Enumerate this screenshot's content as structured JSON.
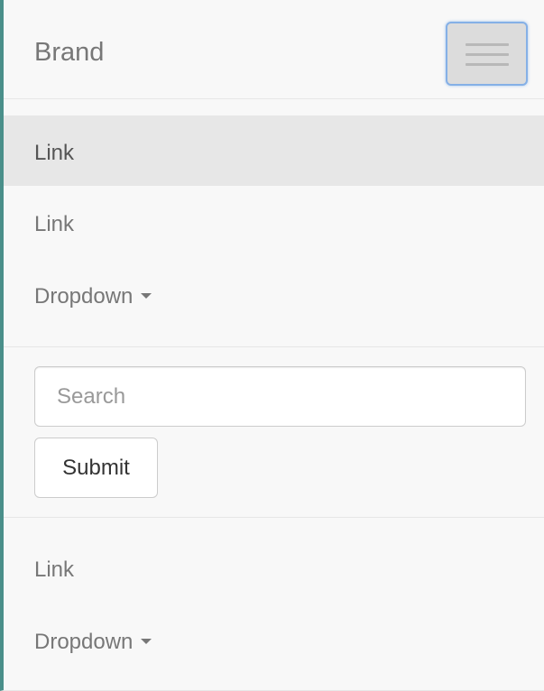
{
  "navbar": {
    "brand": "Brand",
    "toggle_icon": "hamburger-icon"
  },
  "nav_primary": {
    "items": [
      {
        "label": "Link",
        "active": true
      },
      {
        "label": "Link",
        "active": false
      },
      {
        "label": "Dropdown",
        "has_caret": true
      }
    ]
  },
  "search_form": {
    "placeholder": "Search",
    "value": "",
    "submit_label": "Submit"
  },
  "nav_secondary": {
    "items": [
      {
        "label": "Link"
      },
      {
        "label": "Dropdown",
        "has_caret": true
      }
    ]
  },
  "colors": {
    "navbar_bg": "#f8f8f8",
    "active_bg": "#e7e7e7",
    "link_text": "#777777",
    "focus_ring": "#85b0e6"
  }
}
